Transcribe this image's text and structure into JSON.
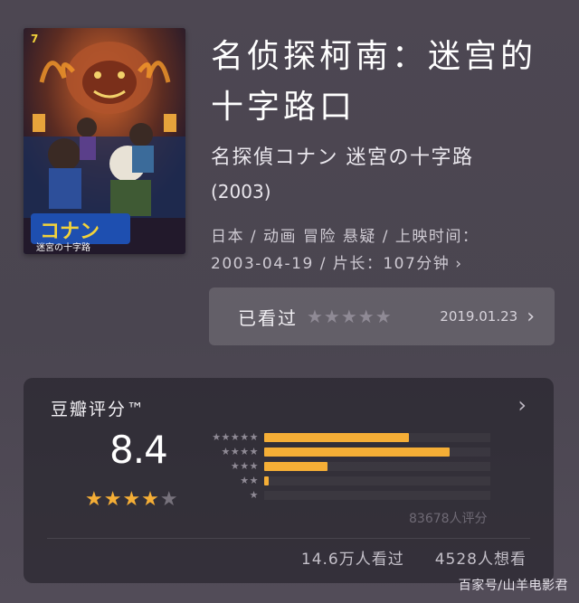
{
  "movie": {
    "title": "名侦探柯南：迷宫的十字路口",
    "original_title": "名探偵コナン 迷宮の十字路",
    "year": "(2003)",
    "meta_line1": "日本 / 动画 冒险 悬疑 / 上映时间：",
    "meta_line2": "2003-04-19 / 片长：107分钟",
    "poster_icon": "poster-image"
  },
  "watched": {
    "label": "已看过",
    "stars": "★★★★★",
    "date": "2019.01.23",
    "chevron": "›"
  },
  "rating": {
    "title": "豆瓣评分™",
    "chevron": "›",
    "score": "8.4",
    "stars_on": "★★★★",
    "stars_off": "★",
    "distribution_percent": [
      32,
      41,
      14,
      1,
      0
    ],
    "distribution_labels": [
      "★★★★★",
      "★★★★",
      "★★★",
      "★★",
      "★"
    ],
    "count": "83678人评分",
    "watched_count": "14.6万人看过",
    "want_count": "4528人想看"
  },
  "watermark": "百家号/山羊电影君",
  "colors": {
    "accent": "#f5ae36",
    "background": "#4b4650",
    "card": "#2e2b33"
  }
}
